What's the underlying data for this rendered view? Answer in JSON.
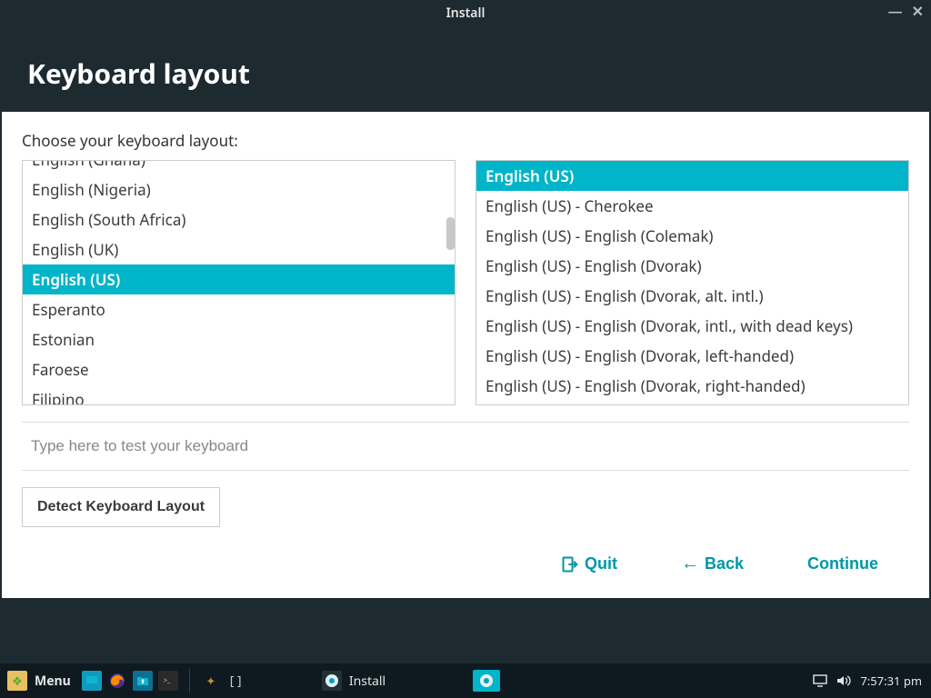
{
  "window": {
    "title": "Install"
  },
  "header": {
    "title": "Keyboard layout"
  },
  "prompt": "Choose your keyboard layout:",
  "layouts": {
    "selected_index": 4,
    "items": [
      "English (Ghana)",
      "English (Nigeria)",
      "English (South Africa)",
      "English (UK)",
      "English (US)",
      "Esperanto",
      "Estonian",
      "Faroese",
      "Filipino"
    ]
  },
  "variants": {
    "selected_index": 0,
    "items": [
      "English (US)",
      "English (US) - Cherokee",
      "English (US) - English (Colemak)",
      "English (US) - English (Dvorak)",
      "English (US) - English (Dvorak, alt. intl.)",
      "English (US) - English (Dvorak, intl., with dead keys)",
      "English (US) - English (Dvorak, left-handed)",
      "English (US) - English (Dvorak, right-handed)"
    ]
  },
  "test_placeholder": "Type here to test your keyboard",
  "detect_label": "Detect Keyboard Layout",
  "nav": {
    "quit": "Quit",
    "back": "Back",
    "continue": "Continue"
  },
  "taskbar": {
    "menu": "Menu",
    "brackets": "[ ]",
    "task_label": "Install",
    "clock": "7:57:31 pm"
  },
  "colors": {
    "accent": "#00b5c9",
    "dark": "#1d2b31"
  }
}
